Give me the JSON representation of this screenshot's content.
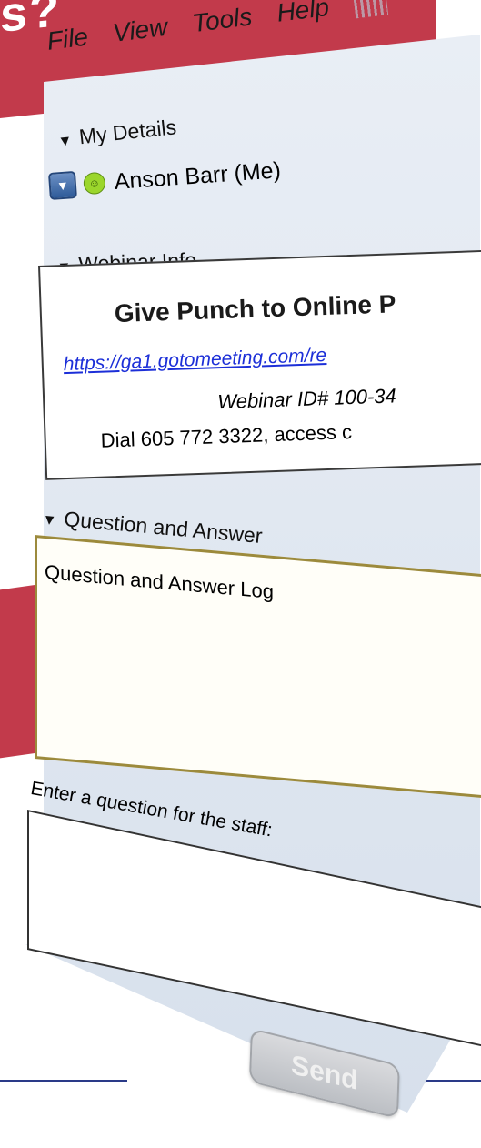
{
  "banner": {
    "text": "s?"
  },
  "menu": {
    "items": [
      "File",
      "View",
      "Tools",
      "Help"
    ]
  },
  "my_details": {
    "header": "My Details",
    "attendee": "Anson Barr (Me)"
  },
  "webinar_info": {
    "header": "Webinar Info",
    "title": "Give Punch to Online P",
    "link": "https://ga1.gotomeeting.com/re",
    "webinar_id": "Webinar ID# 100-34",
    "dial": "Dial 605 772 3322, access c"
  },
  "qa": {
    "header": "Question and Answer",
    "log_label": "Question and Answer Log",
    "input_label": "Enter a question for the staff:",
    "input_value": "",
    "send_label": "Send"
  },
  "colors": {
    "banner": "#c23a4b",
    "link": "#1c2fd8",
    "accent_line": "#2a3a88"
  }
}
